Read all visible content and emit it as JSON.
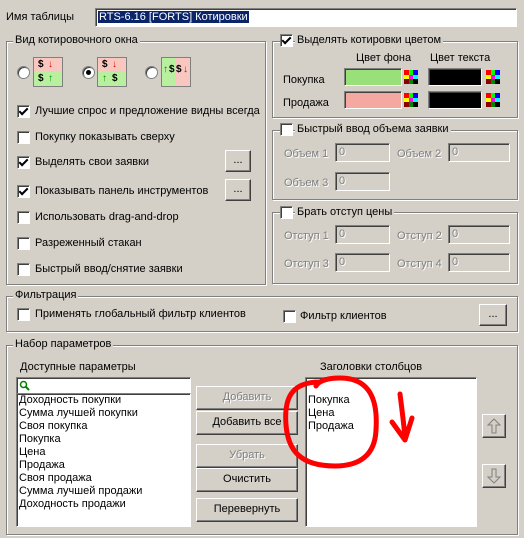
{
  "header": {
    "name_label": "Имя таблицы",
    "name_value": "RTS-6.16 [FORTS] Котировки"
  },
  "view": {
    "title": "Вид котировочного окна",
    "selected_layout": 2,
    "options": [
      {
        "label": "Лучшие спрос и предложение видны всегда",
        "checked": true
      },
      {
        "label": "Покупку показывать сверху",
        "checked": false
      },
      {
        "label": "Выделять свои заявки",
        "checked": true
      },
      {
        "label": "Показывать панель инструментов",
        "checked": true
      },
      {
        "label": "Использовать drag-and-drop",
        "checked": false
      },
      {
        "label": "Разреженный стакан",
        "checked": false
      },
      {
        "label": "Быстрый ввод/снятие заявки",
        "checked": false
      }
    ],
    "ellipsis": "..."
  },
  "colors": {
    "title": "Выделять котировки цветом",
    "checked": true,
    "bg_header": "Цвет фона",
    "text_header": "Цвет текста",
    "buy_label": "Покупка",
    "sell_label": "Продажа",
    "buy_bg": "#99e07a",
    "sell_bg": "#f4a8a0",
    "text_color": "#000000"
  },
  "volume": {
    "title": "Быстрый ввод объема заявки",
    "checked": false,
    "labels": [
      "Объем 1",
      "Объем 2",
      "Объем 3"
    ],
    "values": [
      "0",
      "0",
      "0"
    ]
  },
  "offset": {
    "title": "Брать отступ цены",
    "checked": false,
    "labels": [
      "Отступ 1",
      "Отступ 2",
      "Отступ 3",
      "Отступ 4"
    ],
    "values": [
      "0",
      "0",
      "0",
      "0"
    ]
  },
  "filter": {
    "title": "Фильтрация",
    "global_label": "Применять глобальный фильтр клиентов",
    "global_checked": false,
    "client_label": "Фильтр клиентов",
    "client_checked": false,
    "ellipsis": "..."
  },
  "params": {
    "title": "Набор параметров",
    "available_header": "Доступные параметры",
    "columns_header": "Заголовки столбцов",
    "available": [
      "Доходность покупки",
      "Сумма лучшей покупки",
      "Своя покупка",
      "Покупка",
      "Цена",
      "Продажа",
      "Своя продажа",
      "Сумма лучшей продажи",
      "Доходность продажи"
    ],
    "columns": [
      "Покупка",
      "Цена",
      "Продажа"
    ],
    "buttons": {
      "add": "Добавить",
      "add_all": "Добавить все",
      "remove": "Убрать",
      "clear": "Очистить",
      "reverse": "Перевернуть"
    }
  },
  "accent": {
    "annotation_red": "#ff0000",
    "selection": "#0a246a"
  },
  "icons": {
    "up": "arrow-up-icon",
    "down": "arrow-down-icon",
    "search": "search-icon"
  }
}
